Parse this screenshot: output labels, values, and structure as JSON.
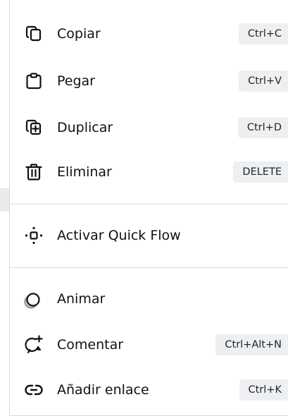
{
  "menu": {
    "items": [
      {
        "label": "Copiar",
        "shortcut": "Ctrl+C",
        "icon": "copy-icon"
      },
      {
        "label": "Pegar",
        "shortcut": "Ctrl+V",
        "icon": "paste-icon"
      },
      {
        "label": "Duplicar",
        "shortcut": "Ctrl+D",
        "icon": "duplicate-icon"
      },
      {
        "label": "Eliminar",
        "shortcut": "DELETE",
        "icon": "trash-icon"
      },
      {
        "label": "Activar Quick Flow",
        "icon": "quick-flow-icon"
      },
      {
        "label": "Animar",
        "icon": "animate-icon"
      },
      {
        "label": "Comentar",
        "shortcut": "Ctrl+Alt+N",
        "icon": "comment-add-icon"
      },
      {
        "label": "Añadir enlace",
        "shortcut": "Ctrl+K",
        "icon": "link-icon"
      }
    ]
  },
  "colors": {
    "text": "#0d1216",
    "shortcut_bg": "#eeeff1",
    "divider": "#d7d9dc",
    "animate_shadow": "#8d9297"
  }
}
